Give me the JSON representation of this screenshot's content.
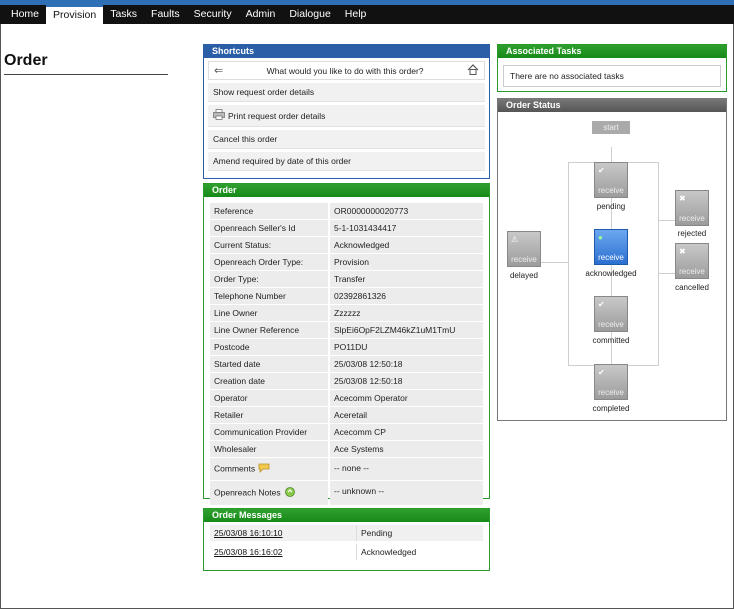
{
  "nav": {
    "items": [
      "Home",
      "Provision",
      "Tasks",
      "Faults",
      "Security",
      "Admin",
      "Dialogue",
      "Help"
    ],
    "active": "Provision"
  },
  "page": {
    "title": "Order"
  },
  "shortcuts": {
    "title": "Shortcuts",
    "question": "What would you like to do with this order?",
    "actions": [
      "Show request order details",
      "Print request order details",
      "Cancel this order",
      "Amend required by date of this order"
    ]
  },
  "order": {
    "title": "Order",
    "rows": [
      {
        "label": "Reference",
        "value": "OR0000000020773"
      },
      {
        "label": "Openreach Seller's Id",
        "value": "5-1-1031434417"
      },
      {
        "label": "Current Status:",
        "value": "Acknowledged"
      },
      {
        "label": "Openreach Order Type:",
        "value": "Provision"
      },
      {
        "label": "Order Type:",
        "value": "Transfer"
      },
      {
        "label": "Telephone Number",
        "value": "02392861326"
      },
      {
        "label": "Line Owner",
        "value": "Zzzzzz"
      },
      {
        "label": "Line Owner Reference",
        "value": "SlpEi6OpF2LZM46kZ1uM1TmU"
      },
      {
        "label": "Postcode",
        "value": "PO11DU"
      },
      {
        "label": "Started date",
        "value": "25/03/08 12:50:18"
      },
      {
        "label": "Creation date",
        "value": "25/03/08 12:50:18"
      },
      {
        "label": "Operator",
        "value": "Acecomm Operator"
      },
      {
        "label": "Retailer",
        "value": "Aceretail"
      },
      {
        "label": "Communication Provider",
        "value": "Acecomm CP"
      },
      {
        "label": "Wholesaler",
        "value": "Ace Systems"
      },
      {
        "label": "Comments",
        "value": "-- none --"
      },
      {
        "label": "Openreach Notes",
        "value": "-- unknown --"
      }
    ]
  },
  "messages": {
    "title": "Order Messages",
    "rows": [
      {
        "date": "25/03/08 16:10:10",
        "status": "Pending"
      },
      {
        "date": "25/03/08 16:16:02",
        "status": "Acknowledged"
      }
    ]
  },
  "tasks": {
    "title": "Associated Tasks",
    "empty": "There are no associated tasks"
  },
  "status": {
    "title": "Order Status",
    "start": "start",
    "node_label": "receive",
    "states": {
      "pending": "pending",
      "acknowledged": "acknowledged",
      "committed": "committed",
      "completed": "completed",
      "delayed": "delayed",
      "rejected": "rejected",
      "cancelled": "cancelled"
    },
    "current": "acknowledged"
  },
  "colors": {
    "nav_bg": "#111111",
    "accent_blue": "#2a5fa8",
    "panel_green": "#2a9a2a",
    "active_state": "#2b6fd0"
  }
}
